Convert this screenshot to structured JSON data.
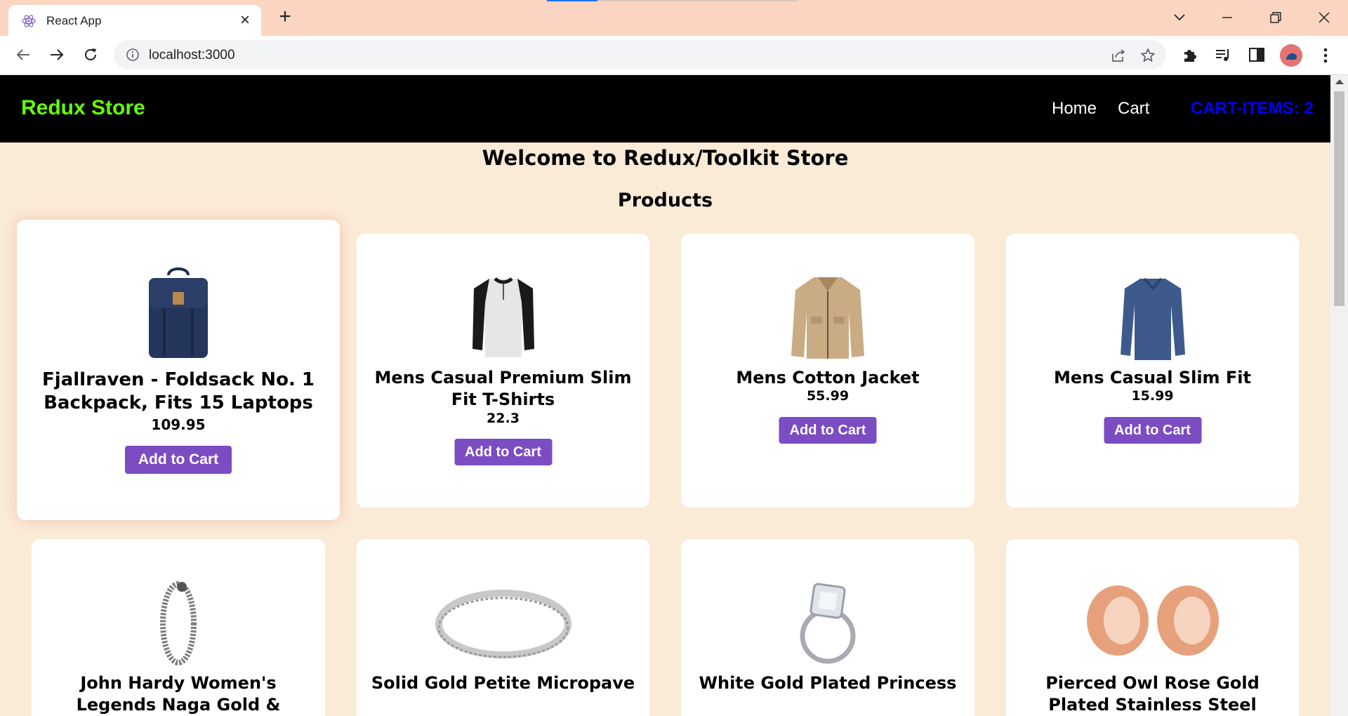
{
  "browser": {
    "tab_title": "React App",
    "url": "localhost:3000"
  },
  "app": {
    "brand": "Redux Store",
    "nav": {
      "home": "Home",
      "cart": "Cart"
    },
    "cart_items_label": "CART-ITEMS: 2",
    "welcome": "Welcome to Redux/Toolkit Store",
    "products_heading": "Products",
    "button_label": "Add to Cart"
  },
  "products": [
    {
      "name": "Fjallraven - Foldsack No. 1 Backpack, Fits 15 Laptops",
      "price": "109.95",
      "image": "backpack-image"
    },
    {
      "name": "Mens Casual Premium Slim Fit T-Shirts",
      "price": "22.3",
      "image": "tshirt-image"
    },
    {
      "name": "Mens Cotton Jacket",
      "price": "55.99",
      "image": "jacket-image"
    },
    {
      "name": "Mens Casual Slim Fit",
      "price": "15.99",
      "image": "longsleeve-image"
    },
    {
      "name": "John Hardy Women's Legends Naga Gold &",
      "price": "",
      "image": "bracelet-image"
    },
    {
      "name": "Solid Gold Petite Micropave",
      "price": "",
      "image": "ring-image"
    },
    {
      "name": "White Gold Plated Princess",
      "price": "",
      "image": "princess-ring-image"
    },
    {
      "name": "Pierced Owl Rose Gold Plated Stainless Steel",
      "price": "",
      "image": "plugs-image"
    }
  ],
  "colors": {
    "page_bg": "#faebd7",
    "nav_bg": "#000000",
    "brand": "#66ff00",
    "cart_items": "#0000ff",
    "button": "#7b4cc2"
  }
}
